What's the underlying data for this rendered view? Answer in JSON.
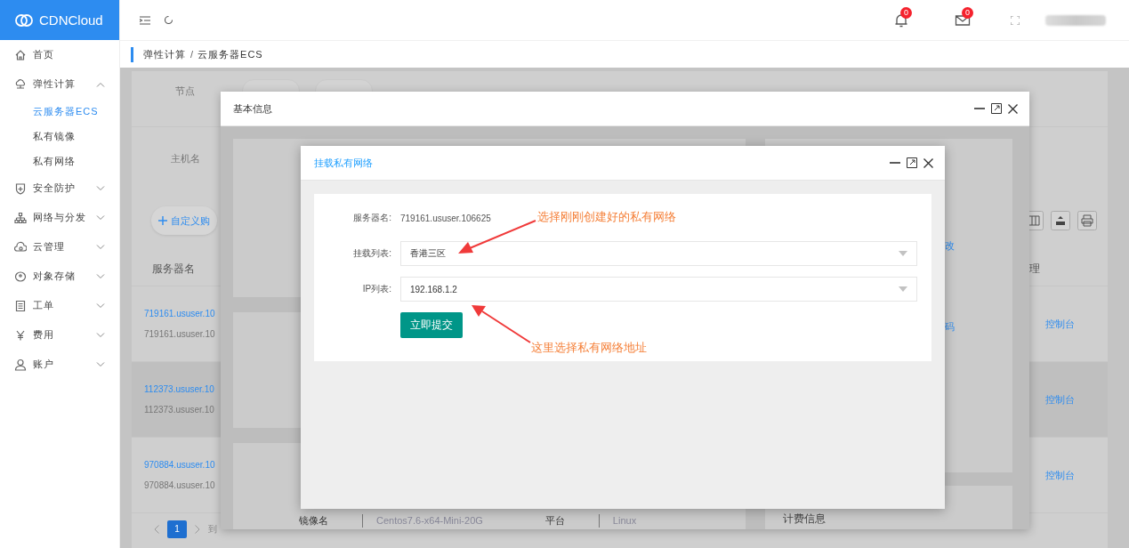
{
  "sidebar": {
    "logo": "CDNCloud",
    "items": [
      {
        "label": "首页",
        "kind": "link"
      },
      {
        "label": "弹性计算",
        "kind": "group",
        "expanded": true,
        "children": [
          {
            "label": "云服务器ECS",
            "selected": true
          },
          {
            "label": "私有镜像",
            "selected": false
          },
          {
            "label": "私有网络",
            "selected": false
          }
        ]
      },
      {
        "label": "安全防护",
        "kind": "group",
        "expanded": false
      },
      {
        "label": "网络与分发",
        "kind": "group",
        "expanded": false
      },
      {
        "label": "云管理",
        "kind": "group",
        "expanded": false
      },
      {
        "label": "对象存储",
        "kind": "group",
        "expanded": false
      },
      {
        "label": "工单",
        "kind": "group",
        "expanded": false
      },
      {
        "label": "费用",
        "kind": "group",
        "expanded": false
      },
      {
        "label": "账户",
        "kind": "group",
        "expanded": false
      }
    ]
  },
  "header": {
    "notifications": "0",
    "messages": "0"
  },
  "breadcrumb": {
    "items": [
      "弹性计算",
      "云服务器ECS"
    ],
    "separator": "/"
  },
  "page": {
    "filters": [
      {
        "label": "节点"
      },
      {
        "label": "主机名"
      }
    ],
    "custom_buy": "自定义购",
    "table": {
      "first_column": "服务器名",
      "last_column": "理",
      "rows": [
        {
          "name": "719161.ususer.10",
          "subtitle": "719161.ususer.10",
          "action": "控制台",
          "highlighted": false
        },
        {
          "name": "112373.ususer.10",
          "subtitle": "112373.ususer.10",
          "action": "控制台",
          "highlighted": true
        },
        {
          "name": "970884.ususer.10",
          "subtitle": "970884.ususer.10",
          "action": "控制台",
          "highlighted": false
        }
      ]
    },
    "pagination": {
      "page": "1",
      "goto": "到"
    }
  },
  "basic_info_dialog": {
    "title": "基本信息",
    "links": [
      "改",
      "码"
    ],
    "billing_title": "计费信息",
    "specs": [
      {
        "label": "镜像名",
        "value": "Centos7.6-x64-Mini-20G"
      },
      {
        "label": "平台",
        "value": "Linux"
      }
    ]
  },
  "mount_dialog": {
    "title": "挂载私有网络",
    "fields": [
      {
        "kind": "text",
        "label": "服务器名:",
        "value": "719161.ususer.106625"
      },
      {
        "kind": "select",
        "label": "挂载列表:",
        "value": "香港三区"
      },
      {
        "kind": "select",
        "label": "IP列表:",
        "value": "192.168.1.2"
      }
    ],
    "submit": "立即提交"
  },
  "annotations": [
    {
      "text": "选择刚刚创建好的私有网络"
    },
    {
      "text": "这里选择私有网络地址"
    }
  ]
}
